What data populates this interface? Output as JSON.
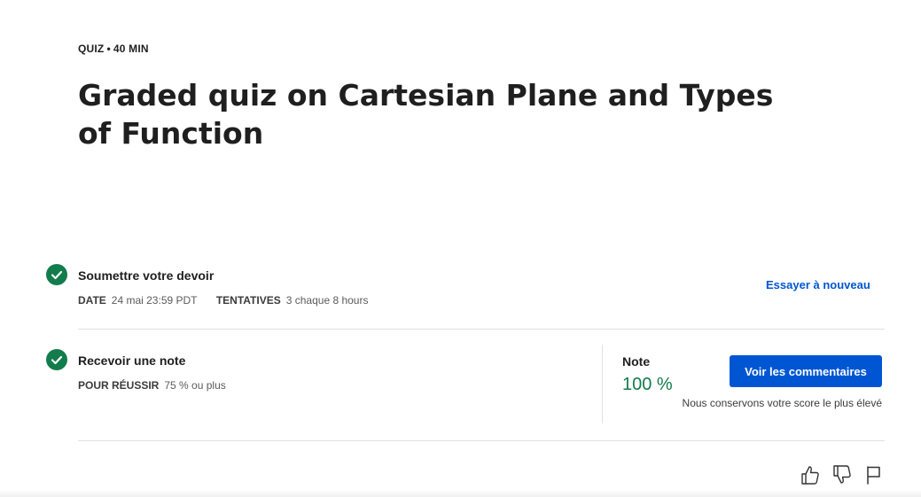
{
  "header": {
    "type_label": "QUIZ",
    "separator": "•",
    "duration": "40  MIN",
    "title": "Graded quiz on Cartesian Plane and Types of Function"
  },
  "submit_step": {
    "title": "Soumettre votre devoir",
    "date_key": "DATE",
    "date_value": "24 mai 23:59 PDT",
    "attempts_key": "TENTATIVES",
    "attempts_value": "3 chaque 8  hours",
    "retry_label": "Essayer à nouveau",
    "status_icon": "check-circle-icon"
  },
  "grade_step": {
    "title": "Recevoir une note",
    "pass_key": "POUR RÉUSSIR",
    "pass_value": "75 % ou plus",
    "grade_label": "Note",
    "grade_value": "100 %",
    "feedback_button": "Voir les commentaires",
    "keep_note": "Nous conservons votre score le plus élevé",
    "status_icon": "check-circle-icon"
  },
  "footer_icons": [
    "thumbs-up-icon",
    "thumbs-down-icon",
    "flag-icon"
  ],
  "colors": {
    "success": "#137c4c",
    "primary": "#0056d2",
    "text": "#1f1f1f",
    "divider": "#e1e1e1"
  }
}
